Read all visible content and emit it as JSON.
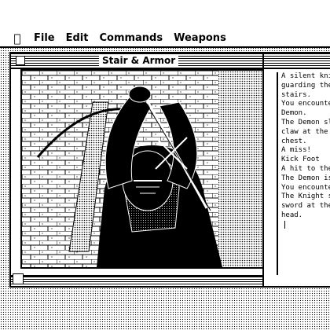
{
  "menubar": {
    "apple": "",
    "items": [
      "File",
      "Edit",
      "Commands",
      "Weapons"
    ]
  },
  "picture_window": {
    "title": "Stair & Armor",
    "image_desc_name": "knight-armor-illustration"
  },
  "text_window": {
    "lines": [
      "A silent knight",
      "guarding the w",
      "stairs.",
      "",
      "You encounter",
      "Demon.",
      "The Demon sla",
      "claw at the Pe",
      "chest.",
      "A miss!",
      "Kick Foot",
      "A hit to the si",
      "The Demon is",
      "You encounter",
      "The Knight sw",
      "sword at the F",
      "head."
    ]
  },
  "colors": {
    "fg": "#000000",
    "bg": "#ffffff"
  }
}
